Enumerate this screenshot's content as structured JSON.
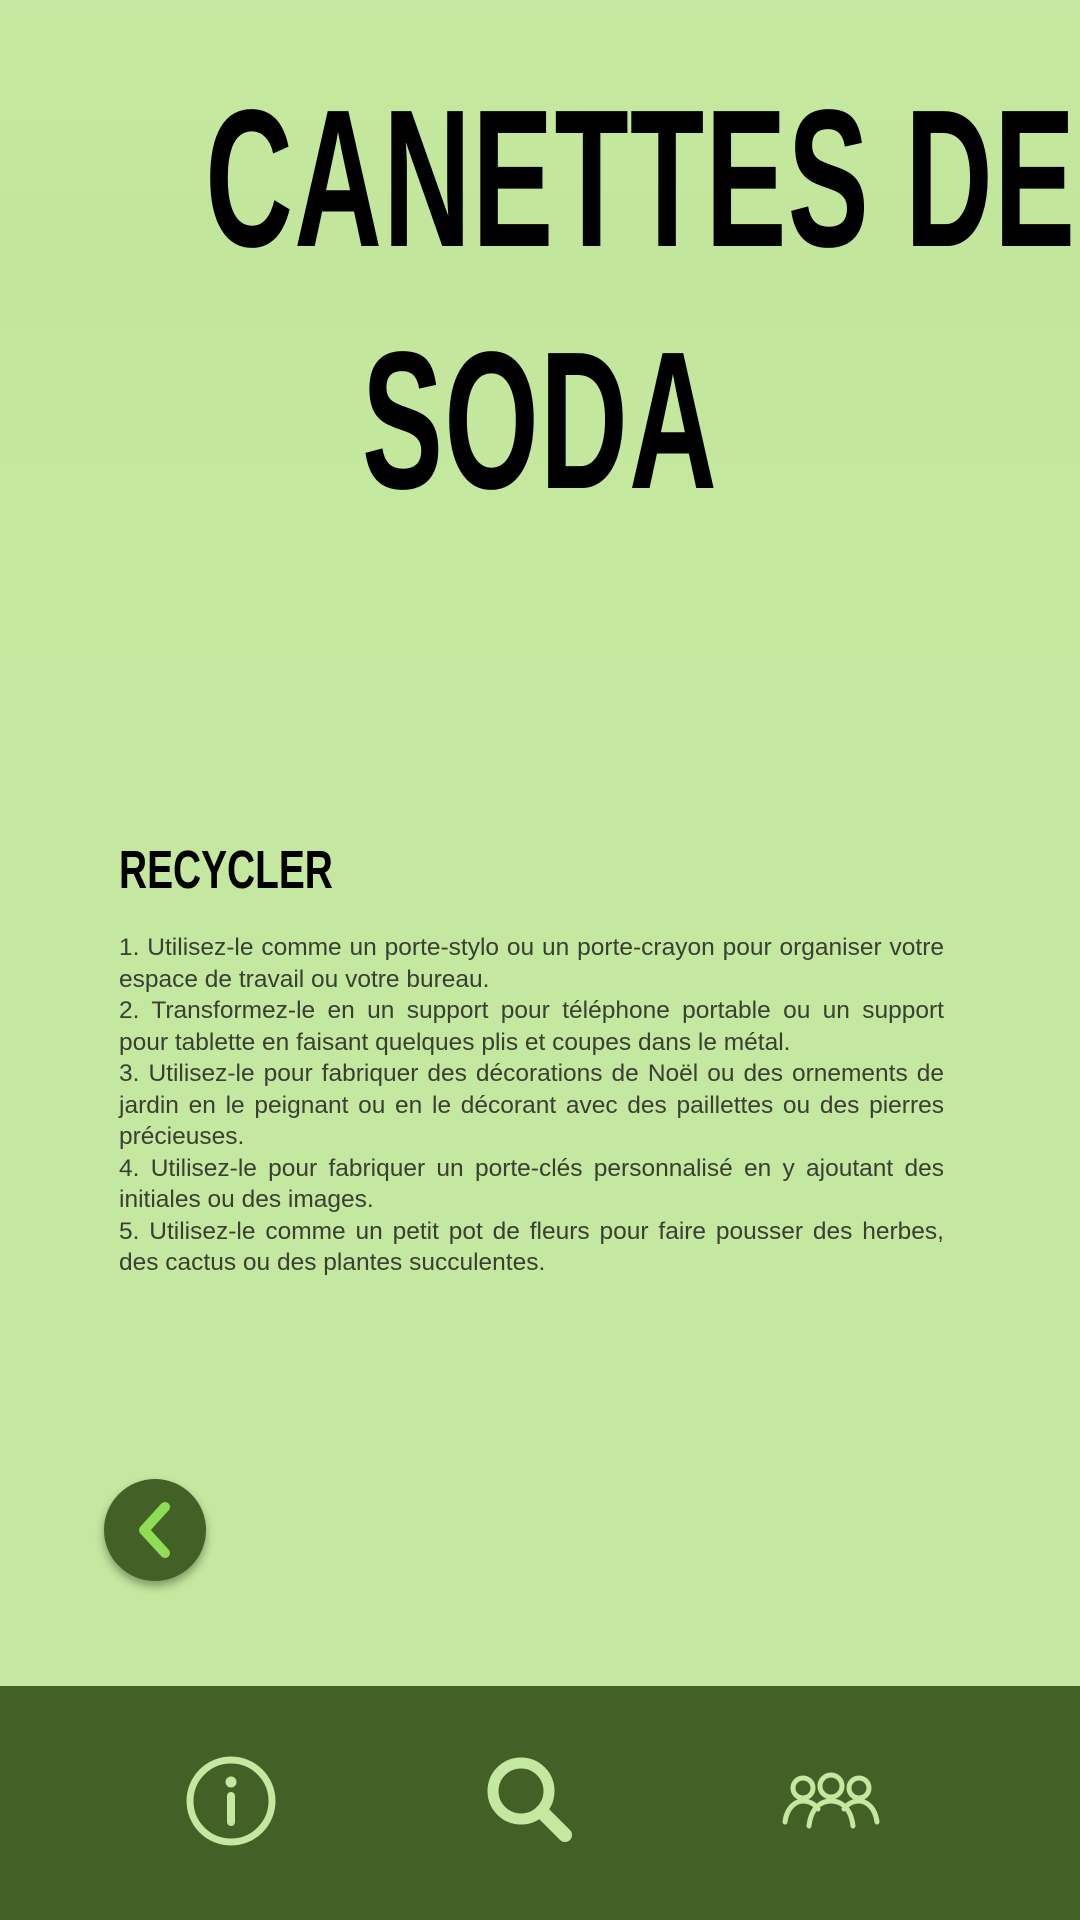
{
  "title": {
    "line1": "CANETTES DE",
    "line2": "SODA"
  },
  "section": {
    "heading": "RECYCLER",
    "tips": [
      "1. Utilisez-le comme un porte-stylo ou un porte-crayon pour organiser votre espace de travail ou votre bureau.",
      "2. Transformez-le en un support pour téléphone portable ou un support pour tablette en faisant quelques plis et coupes dans le métal.",
      "3. Utilisez-le pour fabriquer des décorations de Noël ou des ornements de jardin en le peignant ou en le décorant avec des paillettes ou des pierres précieuses.",
      "4. Utilisez-le pour fabriquer un porte-clés personnalisé en y ajoutant des initiales ou des images.",
      "5. Utilisez-le comme un petit pot de fleurs pour faire pousser des herbes, des cactus ou des plantes succulentes."
    ]
  },
  "back_button": {
    "icon": "chevron-left-icon"
  },
  "bottom_nav": {
    "items": [
      {
        "icon": "info-icon"
      },
      {
        "icon": "search-icon"
      },
      {
        "icon": "people-group-icon"
      }
    ]
  },
  "colors": {
    "background": "#c4e89f",
    "dark_green": "#436026",
    "accent_green": "#8fdc55",
    "icon_light": "#c4e89f",
    "title_text": "#000000",
    "body_text": "#3a3f34"
  }
}
